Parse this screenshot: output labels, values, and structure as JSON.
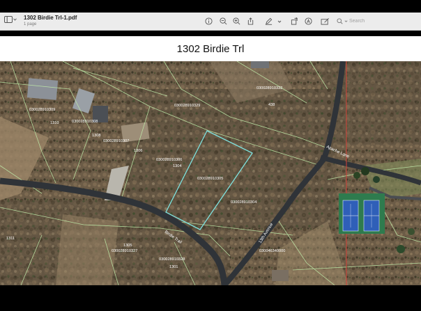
{
  "document": {
    "filename": "1302 Birdie Trl-1.pdf",
    "page_count": "1 page",
    "page_title": "1302 Birdie Trl"
  },
  "search": {
    "placeholder": "Search"
  },
  "toolbar_icons": [
    "sidebar-icon",
    "info-icon",
    "zoom-out-icon",
    "zoom-in-icon",
    "share-icon",
    "markup-pen-icon",
    "chevron-down-icon",
    "rotate-icon",
    "highlight-icon",
    "edit-icon",
    "search-icon"
  ],
  "map": {
    "parcels": {
      "p309": "030028910309",
      "p308": "030028910308",
      "p307": "030028910307",
      "p329": "030028910329",
      "p306": "030028910306",
      "p305": "030028910305",
      "p304": "030028910304",
      "p332": "030028910332",
      "p327": "030028910327",
      "p328": "030028910328",
      "p340000": "030046340000"
    },
    "addresses": {
      "a1310": "1310",
      "a1308": "1308",
      "a1306": "1306",
      "a1304": "1304",
      "a1311": "1311",
      "a1305": "1305",
      "a1301": "1301",
      "a438": "438"
    },
    "roads": {
      "birdie": "Birdie Trail",
      "thirteenth": "13th Avenue",
      "apache": "Apache Lane"
    },
    "colors": {
      "parcel_lines": "#bfe9a8",
      "subject_outline": "#7fe3e0",
      "road": "#2f3338",
      "boundary": "#d3423a",
      "court": "#2f5fb8"
    }
  }
}
